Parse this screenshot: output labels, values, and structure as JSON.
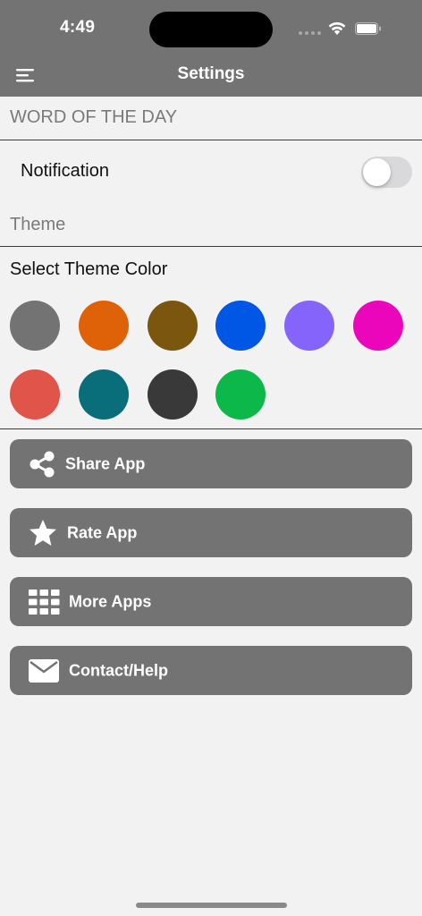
{
  "status_bar": {
    "time": "4:49"
  },
  "header": {
    "title": "Settings",
    "menu_icon": "hamburger-menu-icon"
  },
  "sections": {
    "word_of_the_day": "WORD OF THE DAY",
    "notification_label": "Notification",
    "notification_enabled": false,
    "theme": "Theme",
    "select_theme_color": "Select Theme Color"
  },
  "theme_colors": [
    "#737373",
    "#e06208",
    "#7a560e",
    "#0056e5",
    "#8464fb",
    "#eb05bb",
    "#e0544a",
    "#0a6e7a",
    "#393939",
    "#0db84a"
  ],
  "actions": [
    {
      "label": "Share App",
      "icon": "share-icon"
    },
    {
      "label": "Rate App",
      "icon": "star-icon"
    },
    {
      "label": "More Apps",
      "icon": "grid-icon"
    },
    {
      "label": "Contact/Help",
      "icon": "envelope-icon"
    }
  ]
}
